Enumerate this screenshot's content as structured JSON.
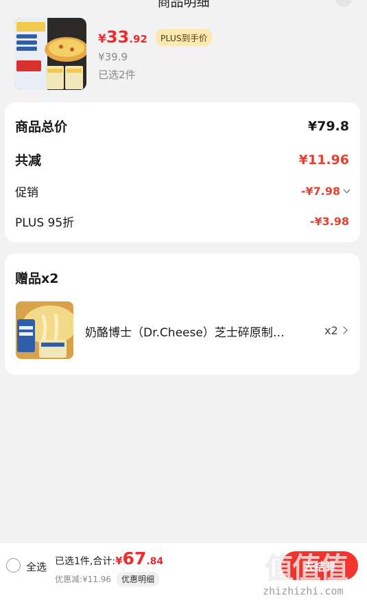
{
  "header": {
    "title": "商品明细"
  },
  "product": {
    "price_symbol": "¥",
    "price_integer": "33",
    "price_decimal": ".92",
    "plus_badge": "PLUS到手价",
    "original_price": "¥39.9",
    "selected_count": "已选2件",
    "thumb_icon": "pizza-product-image"
  },
  "summary": {
    "total_label": "商品总价",
    "total_value": "¥79.8",
    "reduce_label": "共减",
    "reduce_value": "¥11.96",
    "promo_label": "促销",
    "promo_value": "-¥7.98",
    "plus_label": "PLUS 95折",
    "plus_value": "-¥3.98"
  },
  "gifts": {
    "title": "赠品x2",
    "item_name": "奶酪博士（Dr.Cheese）芝士碎原制…",
    "item_qty": "x2",
    "thumb_icon": "cheese-product-image"
  },
  "bottom_bar": {
    "select_all": "全选",
    "total_prefix": "已选1件,合计:",
    "total_symbol": "¥",
    "total_integer": "67",
    "total_decimal": ".84",
    "discount_text": "优惠减:¥11.96",
    "detail_label": "优惠明细",
    "checkout_label": "去结算"
  },
  "watermark": {
    "logo": "值值值",
    "text": "zhizhizhi.com"
  },
  "colors": {
    "accent_red": "#f02b2b",
    "plus_gold_bg": "#fbe9b2",
    "page_bg": "#f2f2f2"
  }
}
